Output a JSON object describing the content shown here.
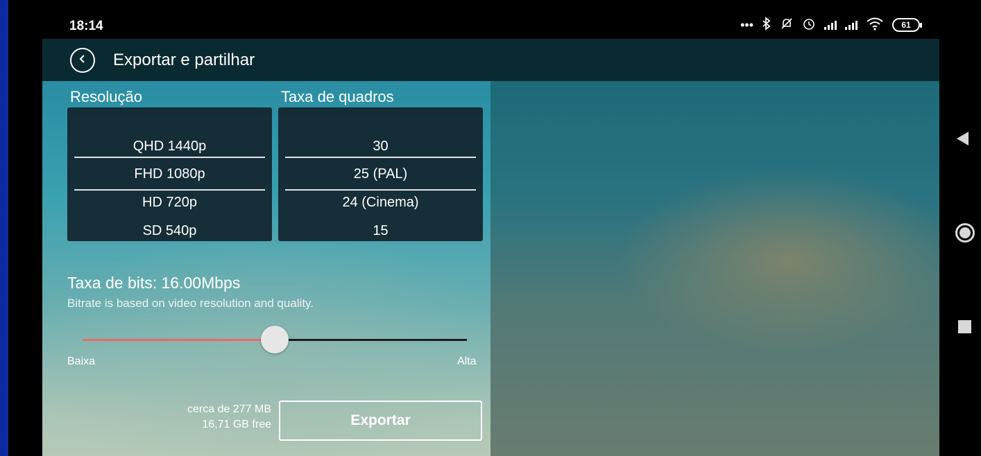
{
  "status_bar": {
    "time": "18:14",
    "more_indicator": "•••",
    "icons": [
      "bluetooth-icon",
      "notifications-off-icon",
      "alarm-icon",
      "signal-icon",
      "signal-icon",
      "wifi-icon"
    ],
    "battery_level": "61"
  },
  "header": {
    "title": "Exportar e partilhar",
    "back_icon": "back-icon"
  },
  "resolution": {
    "label": "Resolução",
    "options": [
      "QHD 1440p",
      "FHD 1080p",
      "HD 720p",
      "SD 540p"
    ],
    "selected": "FHD 1080p"
  },
  "frame_rate": {
    "label": "Taxa de quadros",
    "options": [
      "30",
      "25 (PAL)",
      "24 (Cinema)",
      "15"
    ],
    "selected": "25 (PAL)"
  },
  "bitrate": {
    "title": "Taxa de bits: 16.00Mbps",
    "note": "Bitrate is based on video resolution and quality.",
    "slider_value": 0.5,
    "min_label": "Baixa",
    "max_label": "Alta"
  },
  "export": {
    "size_estimate": "cerca de 277 MB",
    "free_space": "16,71 GB free",
    "button_label": "Exportar"
  },
  "colors": {
    "slider_fill": "#ec6a63",
    "appbar": "#0a2a31"
  },
  "navigation": {
    "icons": [
      "back-triangle-icon",
      "home-circle-icon",
      "recents-square-icon"
    ]
  }
}
